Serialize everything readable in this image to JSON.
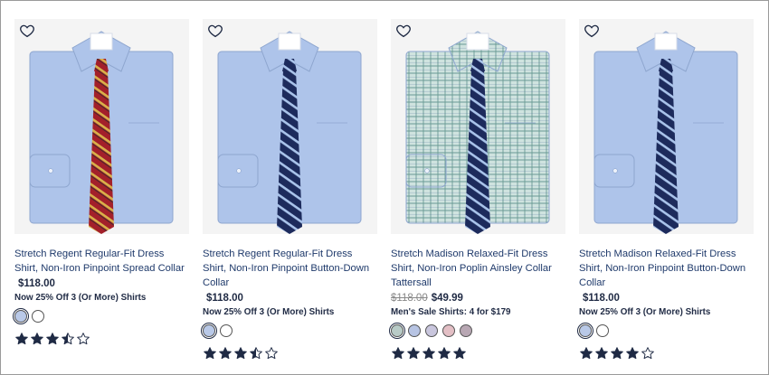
{
  "products": [
    {
      "title": "Stretch Regent Regular-Fit Dress Shirt, Non-Iron Pinpoint Spread Collar",
      "price": "$118.00",
      "old_price": "",
      "promo": "Now 25% Off 3 (Or More) Shirts",
      "swatches": [
        "#b9c9e8",
        "#ffffff"
      ],
      "rating": 3.5,
      "shirt_color": "#aec4ea",
      "tie": "red-gold"
    },
    {
      "title": "Stretch Regent Regular-Fit Dress Shirt, Non-Iron Pinpoint Button-Down Collar",
      "price": "$118.00",
      "old_price": "",
      "promo": "Now 25% Off 3 (Or More) Shirts",
      "swatches": [
        "#b9c9e8",
        "#ffffff"
      ],
      "rating": 3.5,
      "shirt_color": "#aec4ea",
      "tie": "navy-blue"
    },
    {
      "title": "Stretch Madison Relaxed-Fit Dress Shirt, Non-Iron Poplin Ainsley Collar Tattersall",
      "price": "$49.99",
      "old_price": "$118.00",
      "promo": "Men's Sale Shirts: 4 for $179",
      "swatches": [
        "#b8cbc7",
        "#b7c4e3",
        "#c9c6dd",
        "#e3bfc5",
        "#b8a7b3"
      ],
      "rating": 5,
      "shirt_color": "#cfe3df",
      "tie": "navy-blue"
    },
    {
      "title": "Stretch Madison Relaxed-Fit Dress Shirt, Non-Iron Pinpoint Button-Down Collar",
      "price": "$118.00",
      "old_price": "",
      "promo": "Now 25% Off 3 (Or More) Shirts",
      "swatches": [
        "#b9c9e8",
        "#ffffff"
      ],
      "rating": 4,
      "shirt_color": "#aec4ea",
      "tie": "navy-blue"
    }
  ],
  "colors": {
    "text": "#1f2a44",
    "title": "#1f3a6b",
    "star": "#1f2a44"
  },
  "icons": {
    "favorite": "heart-outline-icon",
    "rating": "star-icon"
  }
}
